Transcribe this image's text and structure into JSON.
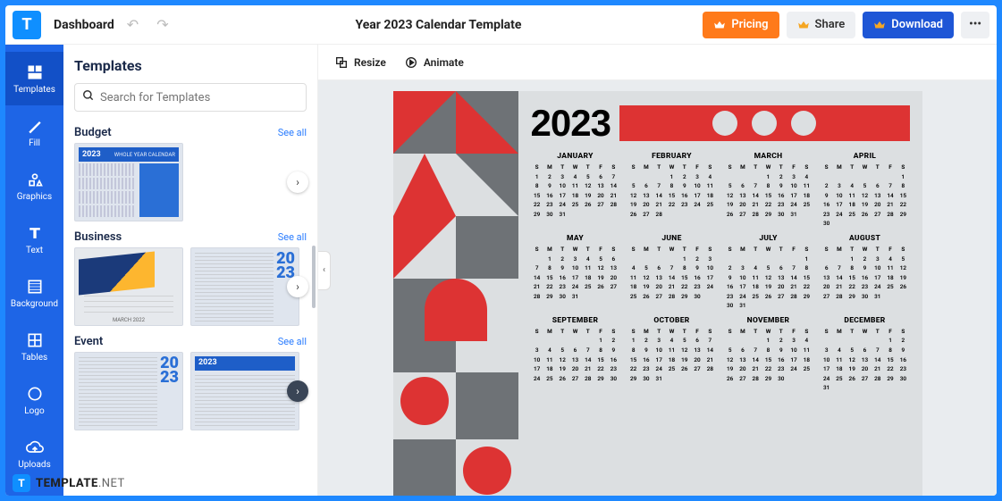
{
  "topbar": {
    "dashboard": "Dashboard",
    "title": "Year 2023 Calendar Template",
    "pricing": "Pricing",
    "share": "Share",
    "download": "Download"
  },
  "rail": [
    {
      "label": "Templates",
      "icon": "templates-icon",
      "active": true
    },
    {
      "label": "Fill",
      "icon": "fill-icon"
    },
    {
      "label": "Graphics",
      "icon": "graphics-icon"
    },
    {
      "label": "Text",
      "icon": "text-icon"
    },
    {
      "label": "Background",
      "icon": "background-icon"
    },
    {
      "label": "Tables",
      "icon": "tables-icon"
    },
    {
      "label": "Logo",
      "icon": "logo-icon"
    },
    {
      "label": "Uploads",
      "icon": "uploads-icon"
    }
  ],
  "panel": {
    "heading": "Templates",
    "search_placeholder": "Search for Templates",
    "seeall": "See all",
    "categories": [
      {
        "name": "Budget"
      },
      {
        "name": "Business"
      },
      {
        "name": "Event"
      }
    ],
    "thumb_year": "2023",
    "thumb_label": "WHOLE YEAR CALENDAR",
    "thumb_march": "MARCH 2022"
  },
  "canvas_toolbar": {
    "resize": "Resize",
    "animate": "Animate"
  },
  "calendar": {
    "year": "2023",
    "dow": [
      "S",
      "M",
      "T",
      "W",
      "T",
      "F",
      "S"
    ],
    "months": [
      {
        "name": "JANUARY",
        "start": 0,
        "days": 31
      },
      {
        "name": "FEBRUARY",
        "start": 3,
        "days": 28
      },
      {
        "name": "MARCH",
        "start": 3,
        "days": 31
      },
      {
        "name": "APRIL",
        "start": 6,
        "days": 30
      },
      {
        "name": "MAY",
        "start": 1,
        "days": 31
      },
      {
        "name": "JUNE",
        "start": 4,
        "days": 30
      },
      {
        "name": "JULY",
        "start": 6,
        "days": 31
      },
      {
        "name": "AUGUST",
        "start": 2,
        "days": 31
      },
      {
        "name": "SEPTEMBER",
        "start": 5,
        "days": 30
      },
      {
        "name": "OCTOBER",
        "start": 0,
        "days": 31
      },
      {
        "name": "NOVEMBER",
        "start": 3,
        "days": 30
      },
      {
        "name": "DECEMBER",
        "start": 5,
        "days": 31
      }
    ]
  },
  "watermark": {
    "brand": "TEMPLATE",
    "suffix": ".NET"
  }
}
